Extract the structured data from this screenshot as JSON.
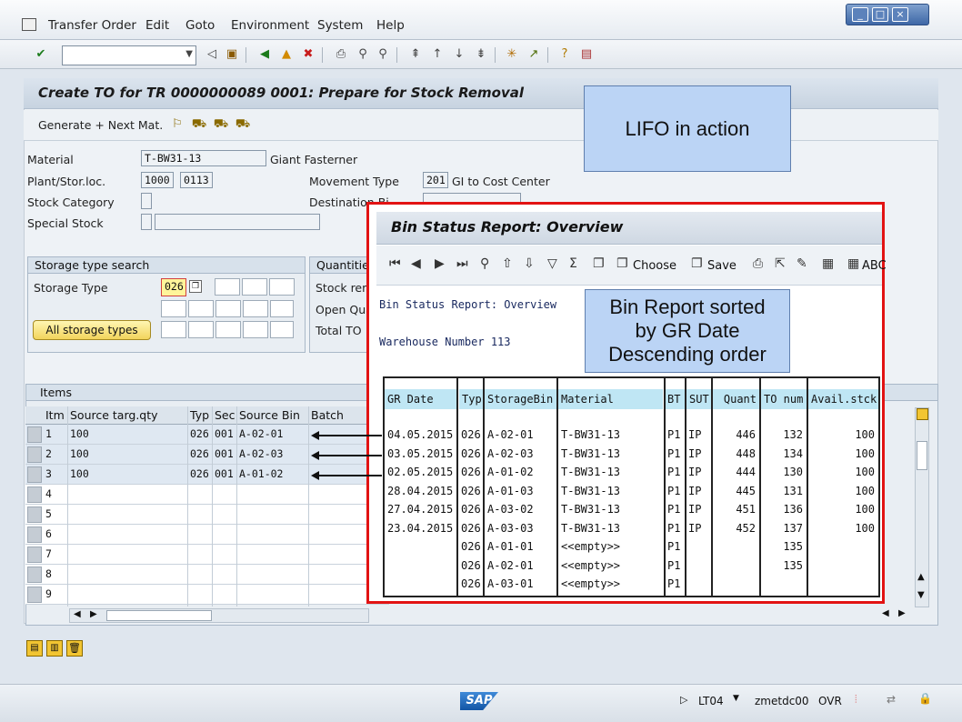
{
  "menu": [
    "Transfer Order",
    "Edit",
    "Goto",
    "Environment",
    "System",
    "Help"
  ],
  "title": "Create TO for TR 0000000089 0001: Prepare for Stock Removal",
  "app_toolbar": {
    "generate": "Generate + Next Mat."
  },
  "header": {
    "material_label": "Material",
    "material": "T-BW31-13",
    "material_desc": "Giant Fasterner",
    "plant_label": "Plant/Stor.loc.",
    "plant": "1000",
    "sloc": "0113",
    "stockcat_label": "Stock Category",
    "special_label": "Special Stock",
    "movtype_label": "Movement Type",
    "movtype": "201",
    "movtype_desc": "GI to Cost Center",
    "dest_label": "Destination Bi"
  },
  "storage_search": {
    "title": "Storage type search",
    "type_label": "Storage Type",
    "type_value": "026",
    "all_button": "All storage types"
  },
  "quantities": {
    "title": "Quantities",
    "stock_label": "Stock rem",
    "open_label": "Open Qua",
    "total_label": "Total TO"
  },
  "items": {
    "title": "Items",
    "columns": [
      "Itm",
      "Source targ.qty",
      "Typ",
      "Sec",
      "Source Bin",
      "Batch"
    ],
    "rows": [
      {
        "itm": "1",
        "qty": "100",
        "typ": "026",
        "sec": "001",
        "bin": "A-02-01"
      },
      {
        "itm": "2",
        "qty": "100",
        "typ": "026",
        "sec": "001",
        "bin": "A-02-03"
      },
      {
        "itm": "3",
        "qty": "100",
        "typ": "026",
        "sec": "001",
        "bin": "A-01-02"
      },
      {
        "itm": "4"
      },
      {
        "itm": "5"
      },
      {
        "itm": "6"
      },
      {
        "itm": "7"
      },
      {
        "itm": "8"
      },
      {
        "itm": "9"
      }
    ]
  },
  "callouts": {
    "lifo": "LIFO in action",
    "sorted": "Bin Report sorted by GR Date Descending order"
  },
  "popup": {
    "title": "Bin Status Report: Overview",
    "choose": "Choose",
    "save": "Save",
    "abc": "ABC",
    "heading": "Bin Status Report: Overview",
    "warehouse": "Warehouse Number 113",
    "columns": [
      "GR Date",
      "Typ",
      "StorageBin",
      "Material",
      "BT",
      "SUT",
      "Quant",
      "TO num",
      "Avail.stck"
    ],
    "rows": [
      [
        "04.05.2015",
        "026",
        "A-02-01",
        "T-BW31-13",
        "P1",
        "IP",
        "446",
        "132",
        "100"
      ],
      [
        "03.05.2015",
        "026",
        "A-02-03",
        "T-BW31-13",
        "P1",
        "IP",
        "448",
        "134",
        "100"
      ],
      [
        "02.05.2015",
        "026",
        "A-01-02",
        "T-BW31-13",
        "P1",
        "IP",
        "444",
        "130",
        "100"
      ],
      [
        "28.04.2015",
        "026",
        "A-01-03",
        "T-BW31-13",
        "P1",
        "IP",
        "445",
        "131",
        "100"
      ],
      [
        "27.04.2015",
        "026",
        "A-03-02",
        "T-BW31-13",
        "P1",
        "IP",
        "451",
        "136",
        "100"
      ],
      [
        "23.04.2015",
        "026",
        "A-03-03",
        "T-BW31-13",
        "P1",
        "IP",
        "452",
        "137",
        "100"
      ],
      [
        "",
        "026",
        "A-01-01",
        "<<empty>>",
        "P1",
        "",
        "",
        "135",
        ""
      ],
      [
        "",
        "026",
        "A-02-01",
        "<<empty>>",
        "P1",
        "",
        "",
        "135",
        ""
      ],
      [
        "",
        "026",
        "A-03-01",
        "<<empty>>",
        "P1",
        "",
        "",
        "",
        ""
      ]
    ]
  },
  "status": {
    "sap": "SAP",
    "tcode": "LT04",
    "server": "zmetdc00",
    "mode": "OVR"
  }
}
